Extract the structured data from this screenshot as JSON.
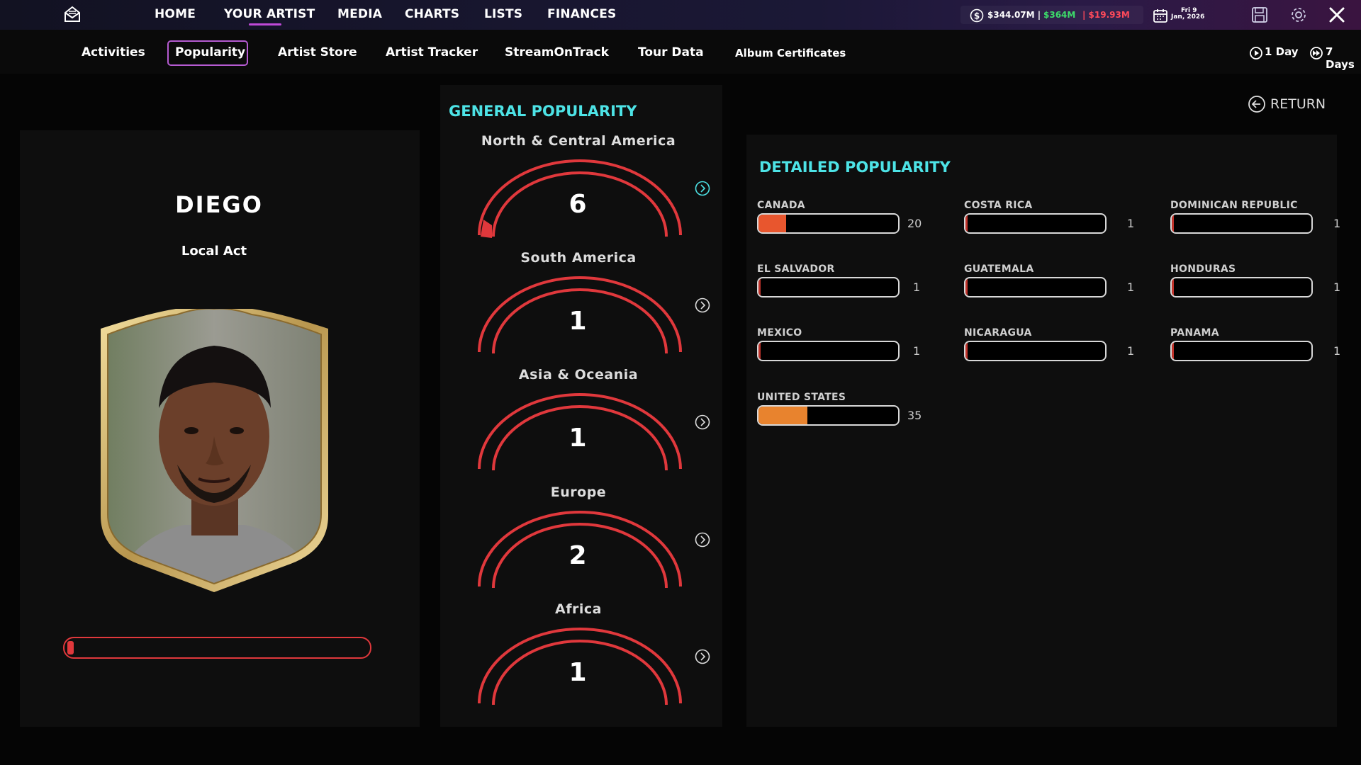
{
  "topnav": {
    "items": [
      "HOME",
      "YOUR ARTIST",
      "MEDIA",
      "CHARTS",
      "LISTS",
      "FINANCES"
    ],
    "balance": "$344.07M |",
    "income": "$364M",
    "expense": "| $19.93M",
    "date_line1": "Fri 9",
    "date_line2": "Jan, 2026"
  },
  "subnav": {
    "items": [
      "Activities",
      "Popularity",
      "Artist Store",
      "Artist Tracker",
      "StreamOnTrack",
      "Tour Data",
      "Album Certificates"
    ],
    "active": "Popularity",
    "time_1day": "1 Day",
    "time_7days": "7 Days"
  },
  "artist": {
    "name": "DIEGO",
    "tier": "Local Act",
    "progress": 0.02
  },
  "general_popularity": {
    "title": "GENERAL POPULARITY",
    "regions": [
      {
        "name": "North & Central America",
        "value": "6",
        "fill": 0.06
      },
      {
        "name": "South America",
        "value": "1",
        "fill": 0.0
      },
      {
        "name": "Asia & Oceania",
        "value": "1",
        "fill": 0.0
      },
      {
        "name": "Europe",
        "value": "2",
        "fill": 0.0
      },
      {
        "name": "Africa",
        "value": "1",
        "fill": 0.0
      }
    ]
  },
  "return_label": "RETURN",
  "detailed_popularity": {
    "title": "DETAILED POPULARITY",
    "countries": [
      {
        "name": "CANADA",
        "value": "20",
        "fill": 0.2,
        "color": "#e8562e"
      },
      {
        "name": "COSTA RICA",
        "value": "1",
        "fill": 0.01,
        "color": "#c0332b"
      },
      {
        "name": "DOMINICAN REPUBLIC",
        "value": "1",
        "fill": 0.01,
        "color": "#c0332b"
      },
      {
        "name": "EL SALVADOR",
        "value": "1",
        "fill": 0.01,
        "color": "#c0332b"
      },
      {
        "name": "GUATEMALA",
        "value": "1",
        "fill": 0.01,
        "color": "#c0332b"
      },
      {
        "name": "HONDURAS",
        "value": "1",
        "fill": 0.01,
        "color": "#c0332b"
      },
      {
        "name": "MEXICO",
        "value": "1",
        "fill": 0.01,
        "color": "#c0332b"
      },
      {
        "name": "NICARAGUA",
        "value": "1",
        "fill": 0.01,
        "color": "#c0332b"
      },
      {
        "name": "PANAMA",
        "value": "1",
        "fill": 0.01,
        "color": "#c0332b"
      },
      {
        "name": "UNITED STATES",
        "value": "35",
        "fill": 0.35,
        "color": "#e8832e"
      }
    ]
  },
  "colors": {
    "accent_cyan": "#4de3e6",
    "gauge_red": "#e0383c",
    "income_green": "#3ddc6a",
    "expense_red": "#ff4a5a",
    "active_purple": "#b65bd2"
  }
}
